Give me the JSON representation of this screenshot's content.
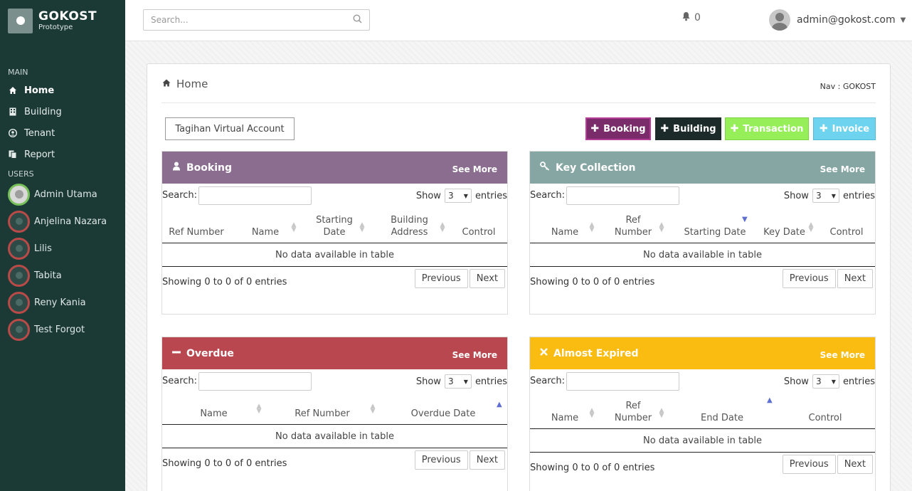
{
  "brand": {
    "name": "GOKOST",
    "sub": "Prototype"
  },
  "sidebar": {
    "main_label": "MAIN",
    "items": [
      {
        "label": "Home",
        "icon": "home-icon"
      },
      {
        "label": "Building",
        "icon": "building-icon"
      },
      {
        "label": "Tenant",
        "icon": "user-circle-icon"
      },
      {
        "label": "Report",
        "icon": "report-icon"
      }
    ],
    "users_label": "USERS",
    "users": [
      {
        "name": "Admin Utama"
      },
      {
        "name": "Anjelina Nazara"
      },
      {
        "name": "Lilis"
      },
      {
        "name": "Tabita"
      },
      {
        "name": "Reny Kania"
      },
      {
        "name": "Test Forgot"
      }
    ]
  },
  "topbar": {
    "search_placeholder": "Search...",
    "notifications": "0",
    "user": "admin@gokost.com"
  },
  "breadcrumb": {
    "title": "Home",
    "nav": "Nav : GOKOST"
  },
  "actions": {
    "virtual_account": "Tagihan Virtual Account",
    "booking": "Booking",
    "building": "Building",
    "transaction": "Transaction",
    "invoice": "Invoice"
  },
  "colors": {
    "booking": "#8a6d8f",
    "key": "#86a6a3",
    "overdue": "#b9474f",
    "expired": "#fbbc11",
    "btn_booking": "#7a2c6a",
    "btn_building": "#1c2b2a",
    "btn_transaction": "#96ee59",
    "btn_invoice": "#6ed3ee"
  },
  "common": {
    "search_label": "Search:",
    "show": "Show",
    "entries_value": "3",
    "entries": "entries",
    "empty": "No data available in table",
    "info": "Showing 0 to 0 of 0 entries",
    "previous": "Previous",
    "next": "Next",
    "see_more": "See More"
  },
  "panels": {
    "booking": {
      "title": "Booking",
      "columns": [
        "Ref Number",
        "Name",
        "Starting Date",
        "Building Address",
        "Control"
      ]
    },
    "key": {
      "title": "Key Collection",
      "columns": [
        "Name",
        "Ref Number",
        "Starting Date",
        "Key Date",
        "Control"
      ]
    },
    "overdue": {
      "title": "Overdue",
      "columns": [
        "Name",
        "Ref Number",
        "Overdue Date"
      ]
    },
    "expired": {
      "title": "Almost Expired",
      "columns": [
        "Name",
        "Ref Number",
        "End Date",
        "Control"
      ]
    }
  }
}
